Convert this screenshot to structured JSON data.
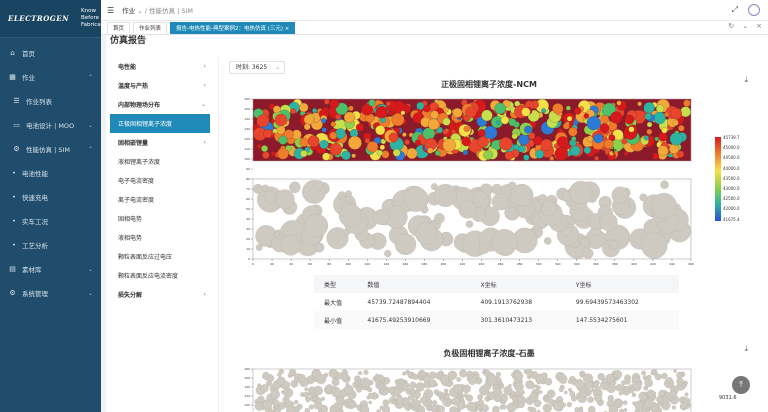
{
  "sidebar": {
    "logo_text": "ELECTROGEN",
    "logo_tagline": [
      "Know",
      "Before",
      "Fabricate"
    ],
    "items": [
      {
        "label": "首页",
        "icon": "home-icon"
      },
      {
        "label": "作业",
        "icon": "grid-icon"
      },
      {
        "label": "作业列表",
        "icon": "list-icon"
      },
      {
        "label": "电池设计 | MOO",
        "icon": "battery-icon"
      },
      {
        "label": "性能仿真 | SIM",
        "icon": "gear-icon"
      },
      {
        "label": "电池性能"
      },
      {
        "label": "快速充电"
      },
      {
        "label": "实车工况"
      },
      {
        "label": "工艺分析"
      },
      {
        "label": "素材库",
        "icon": "library-icon"
      },
      {
        "label": "系统管理",
        "icon": "settings-icon"
      }
    ]
  },
  "topbar": {
    "breadcrumb_1": "作业",
    "breadcrumb_2": "性能仿真 | SIM"
  },
  "tabs": [
    {
      "label": "首页"
    },
    {
      "label": "作业列表"
    },
    {
      "label": "报告-电热性能-典型案例2：电热仿真 (三元)"
    }
  ],
  "main": {
    "page_title": "仿真报告",
    "tree": [
      {
        "label": "电性能"
      },
      {
        "label": "温度与产热"
      },
      {
        "label": "内部物理场分布"
      },
      {
        "label": "正极固相锂离子浓度"
      },
      {
        "label": "固相嵌锂量"
      },
      {
        "label": "液相锂离子浓度"
      },
      {
        "label": "电子电流密度"
      },
      {
        "label": "离子电流密度"
      },
      {
        "label": "固相电势"
      },
      {
        "label": "液相电势"
      },
      {
        "label": "颗粒表面反应过电压"
      },
      {
        "label": "颗粒表面反应电流密度"
      },
      {
        "label": "损失分解"
      }
    ],
    "time_label": "时刻: 3625"
  },
  "chart1": {
    "title": "正极固相锂离子浓度-NCM",
    "colorbar_ticks": [
      "45739.7",
      "45000.0",
      "44500.0",
      "44000.0",
      "43500.0",
      "43000.0",
      "42500.0",
      "42000.0",
      "41675.4"
    ],
    "y_ticks": [
      "160",
      "150",
      "140",
      "130",
      "120",
      "110",
      "100",
      "90",
      "80",
      "70",
      "60",
      "50",
      "40",
      "30",
      "20",
      "10",
      "0"
    ],
    "x_ticks": [
      "0",
      "20",
      "40",
      "60",
      "80",
      "100",
      "120",
      "140",
      "160",
      "180",
      "200",
      "220",
      "240",
      "260",
      "280",
      "300",
      "320",
      "340",
      "360",
      "380",
      "400",
      "420",
      "440",
      "460"
    ]
  },
  "table": {
    "headers": [
      "类型",
      "数值",
      "X坐标",
      "Y坐标"
    ],
    "rows": [
      [
        "最大值",
        "45739.72487894404",
        "409.1913762938",
        "99.69439573463302"
      ],
      [
        "最小值",
        "41675.49253910669",
        "301.3610473213",
        "147.5534275601"
      ]
    ]
  },
  "chart2": {
    "title": "负极固相锂离子浓度-石墨",
    "y_ticks": [
      "160",
      "150",
      "140",
      "130",
      "120",
      "110"
    ],
    "colorbar_top": "9031.6"
  },
  "colors": {
    "sidebar": "#1f4d6b",
    "accent": "#1f8ab8"
  }
}
